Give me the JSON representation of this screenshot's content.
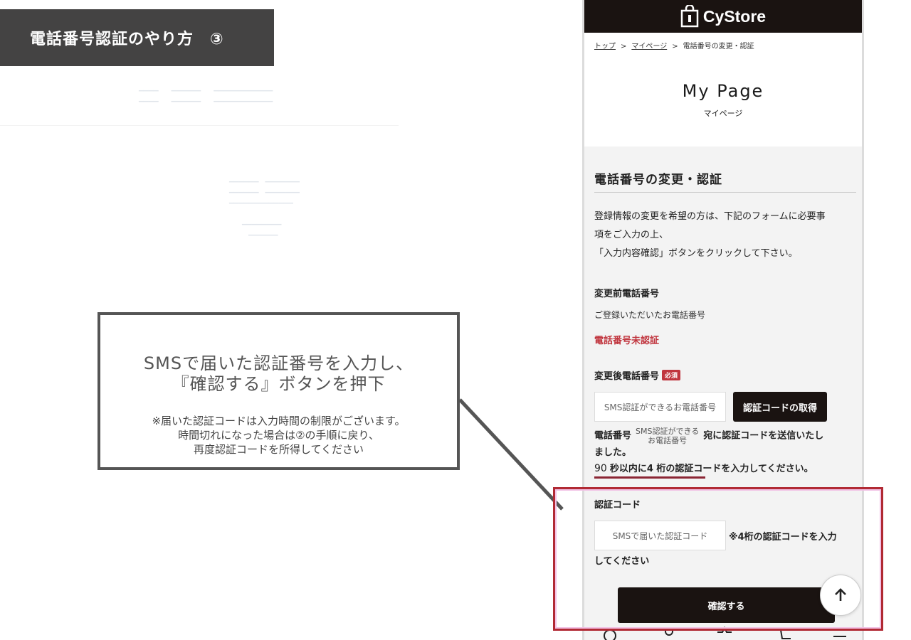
{
  "guide": {
    "title": "電話番号認証のやり方　③",
    "callout_main_1": "SMSで届いた認証番号を入力し、",
    "callout_main_2": "『確認する』ボタンを押下",
    "callout_note_1": "※届いた認証コードは入力時間の制限がございます。",
    "callout_note_2": "時間切れになった場合は②の手順に戻り、",
    "callout_note_3": "再度認証コードを所得してください"
  },
  "header": {
    "brand": "CyStore"
  },
  "breadcrumb": {
    "top": "トップ",
    "mypage": "マイページ",
    "current": "電話番号の変更・認証"
  },
  "page": {
    "title": "My Page",
    "subtitle": "マイページ"
  },
  "form": {
    "section_title": "電話番号の変更・認証",
    "intro_1": "登録情報の変更を希望の方は、下記のフォームに必要事",
    "intro_2": "項をご入力の上、",
    "intro_3": "「入力内容確認」ボタンをクリックして下さい。",
    "before_label": "変更前電話番号",
    "before_sub": "ご登録いただいたお電話番号",
    "before_status": "電話番号未認証",
    "after_label": "変更後電話番号",
    "required_badge": "必須",
    "phone_placeholder": "SMS認証ができるお電話番号",
    "get_code_button": "認証コードの取得",
    "sent_prefix": "電話番号",
    "sent_number_1": "SMS認証ができる",
    "sent_number_2": "お電話番号",
    "sent_suffix_1": "宛に認証コードを送信いたし",
    "sent_suffix_2": "ました。",
    "timer_seconds": "90",
    "timer_text": "秒以内に4 桁の認証コードを入力してください。",
    "code_label": "認証コード",
    "code_placeholder": "SMSで届いた認証コード",
    "code_hint_1": "※4桁の認証コードを入力",
    "code_hint_2": "してください",
    "confirm_button": "確認する"
  },
  "colors": {
    "header_bg": "#1a1311",
    "accent_red": "#c0343d",
    "highlight_border": "#b12a34",
    "guide_bg": "#444343"
  }
}
